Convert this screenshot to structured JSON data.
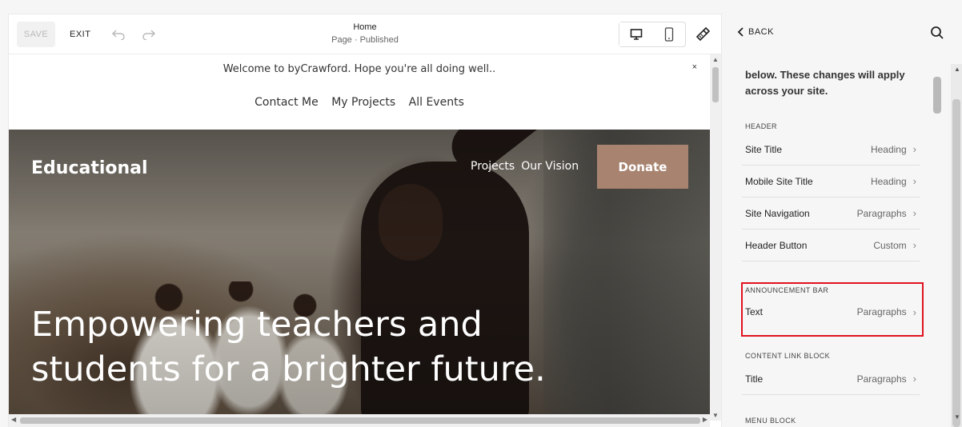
{
  "toolbar": {
    "save_label": "SAVE",
    "exit_label": "EXIT",
    "page_title": "Home",
    "page_status": "Page · Published",
    "undo_icon": "undo-icon",
    "redo_icon": "redo-icon",
    "desktop_icon": "desktop-icon",
    "mobile_icon": "mobile-icon",
    "style_icon": "paint-brush-icon"
  },
  "announcement": {
    "text": "Welcome to byCrawford. Hope you're all doing well..",
    "close": "×"
  },
  "top_nav": [
    "Contact Me",
    "My Projects",
    "All Events"
  ],
  "hero": {
    "brand": "Educational",
    "nav": [
      "Projects",
      "Our Vision"
    ],
    "donate_label": "Donate",
    "headline_line1": "Empowering teachers and",
    "headline_line2": "students for a brighter future."
  },
  "sidebar": {
    "back_label": "BACK",
    "intro": "below. These changes will apply across your site.",
    "sections": [
      {
        "label": "HEADER",
        "rows": [
          {
            "name": "Site Title",
            "value": "Heading"
          },
          {
            "name": "Mobile Site Title",
            "value": "Heading"
          },
          {
            "name": "Site Navigation",
            "value": "Paragraphs"
          },
          {
            "name": "Header Button",
            "value": "Custom"
          }
        ]
      },
      {
        "label": "ANNOUNCEMENT BAR",
        "rows": [
          {
            "name": "Text",
            "value": "Paragraphs"
          }
        ]
      },
      {
        "label": "CONTENT LINK BLOCK",
        "rows": [
          {
            "name": "Title",
            "value": "Paragraphs"
          }
        ]
      },
      {
        "label": "MENU BLOCK",
        "rows": []
      }
    ]
  },
  "colors": {
    "donate_bg": "#a88470",
    "highlight": "#e0121f"
  }
}
